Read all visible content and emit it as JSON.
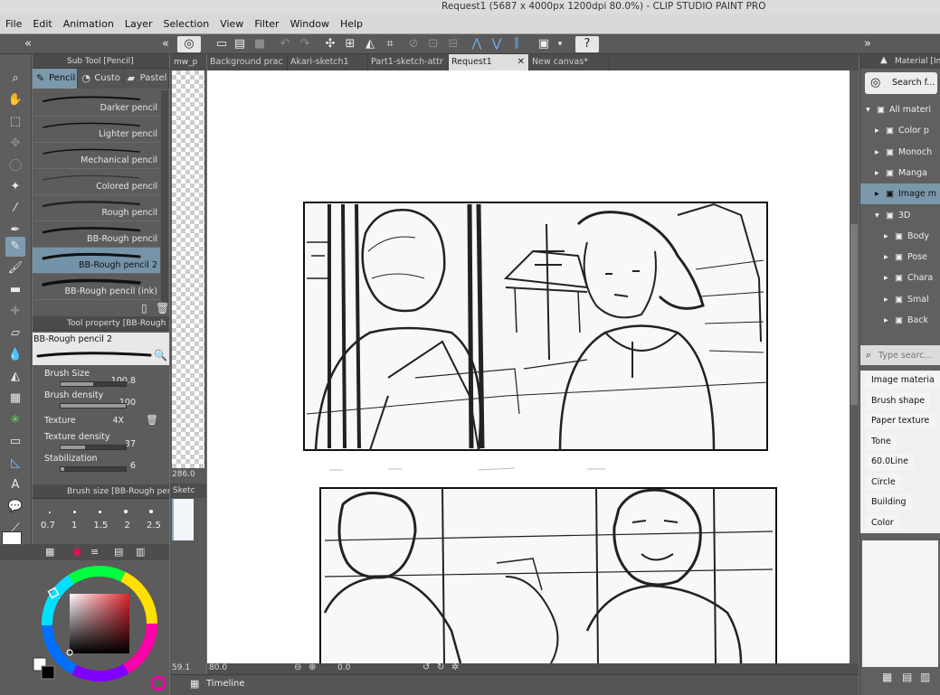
{
  "window": {
    "title": "Request1 (5687 x 4000px 1200dpi 80.0%)  - CLIP STUDIO PAINT PRO"
  },
  "menu": [
    "File",
    "Edit",
    "Animation",
    "Layer",
    "Selection",
    "View",
    "Filter",
    "Window",
    "Help"
  ],
  "subtool": {
    "header": "Sub Tool [Pencil]",
    "tabs": [
      "Pencil",
      "Custo",
      "Pastel"
    ],
    "brushes": [
      "Darker pencil",
      "Lighter pencil",
      "Mechanical pencil",
      "Colored pencil",
      "Rough pencil",
      "BB-Rough pencil",
      "BB-Rough pencil 2",
      "BB-Rough pencil (ink)"
    ],
    "selected_index": 6
  },
  "toolprop": {
    "header": "Tool property [BB-Rough pen",
    "brush_name": "BB-Rough pencil 2",
    "rows": [
      {
        "label": "Brush Size",
        "value": "100.8",
        "fill": 0.5
      },
      {
        "label": "Brush density",
        "value": "100",
        "fill": 1.0
      },
      {
        "label": "Texture",
        "value": "4X"
      },
      {
        "label": "Texture density",
        "value": "37",
        "fill": 0.37
      },
      {
        "label": "Stabilization",
        "value": "6",
        "fill": 0.06
      }
    ]
  },
  "brushsize": {
    "header": "Brush size [BB-Rough pencil",
    "values": [
      "0.7",
      "1",
      "1.5",
      "2",
      "2.5"
    ]
  },
  "layers": {
    "tab": "mw_p",
    "zoom": "286.0",
    "sketch_tab": "Sketc",
    "bottom_value": "59.1"
  },
  "doc_tabs": [
    "Background prac",
    "Akari-sketch1",
    "Part1-sketch-attr",
    "Request1",
    "New canvas*"
  ],
  "active_tab": 3,
  "canvas_status": {
    "zoom": "80.0",
    "rotation": "0.0"
  },
  "timeline": {
    "label": "Timeline"
  },
  "material": {
    "header": "Material [Ima",
    "search_btn": "Search f...",
    "tree": [
      {
        "label": "All materi",
        "indent": 0
      },
      {
        "label": "Color p",
        "indent": 1
      },
      {
        "label": "Monoch",
        "indent": 1
      },
      {
        "label": "Manga",
        "indent": 1
      },
      {
        "label": "Image m",
        "indent": 1
      },
      {
        "label": "3D",
        "indent": 1
      },
      {
        "label": "Body",
        "indent": 2
      },
      {
        "label": "Pose",
        "indent": 2
      },
      {
        "label": "Chara",
        "indent": 2
      },
      {
        "label": "Smal",
        "indent": 2
      },
      {
        "label": "Back",
        "indent": 2
      }
    ],
    "tree_selected": 4,
    "search_placeholder": "Type searc...",
    "tags": [
      "Image materia",
      "Brush shape",
      "Paper texture",
      "Tone",
      "60.0Line",
      "Circle",
      "Building",
      "Color"
    ]
  },
  "colors": {
    "accent": "#7b98ad",
    "panel": "#5c5c5c",
    "canvas": "#ffffff"
  }
}
